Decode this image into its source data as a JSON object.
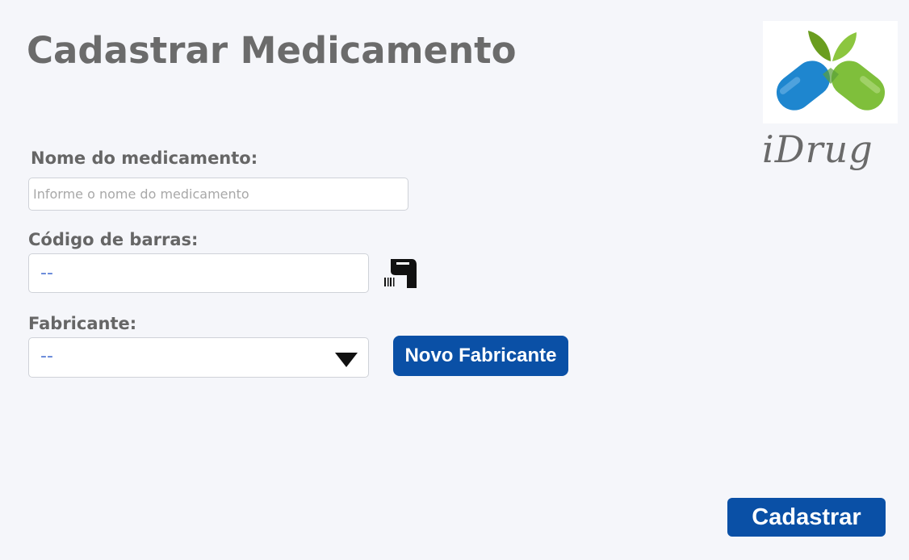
{
  "page": {
    "title": "Cadastrar Medicamento"
  },
  "brand": {
    "name": "iDrug",
    "logo_icon": "pill-leaves-logo",
    "colors": {
      "pill_blue": "#1e86cf",
      "pill_green": "#7fbf3b",
      "leaf_dark": "#6a9d1e",
      "leaf_light": "#8cc63f"
    }
  },
  "form": {
    "name_field": {
      "label": "Nome do medicamento:",
      "placeholder": "Informe o nome do medicamento",
      "value": ""
    },
    "barcode_field": {
      "label": "Código de barras:",
      "placeholder": "--",
      "value": "",
      "scanner_icon": "barcode-scanner-icon"
    },
    "manufacturer_field": {
      "label": "Fabricante:",
      "selected": "--"
    },
    "new_manufacturer_button": "Novo Fabricante",
    "submit_button": "Cadastrar"
  },
  "colors": {
    "background": "#f5f6fa",
    "button": "#0a50a6",
    "label": "#666666",
    "accent_text": "#5b7fd6"
  }
}
